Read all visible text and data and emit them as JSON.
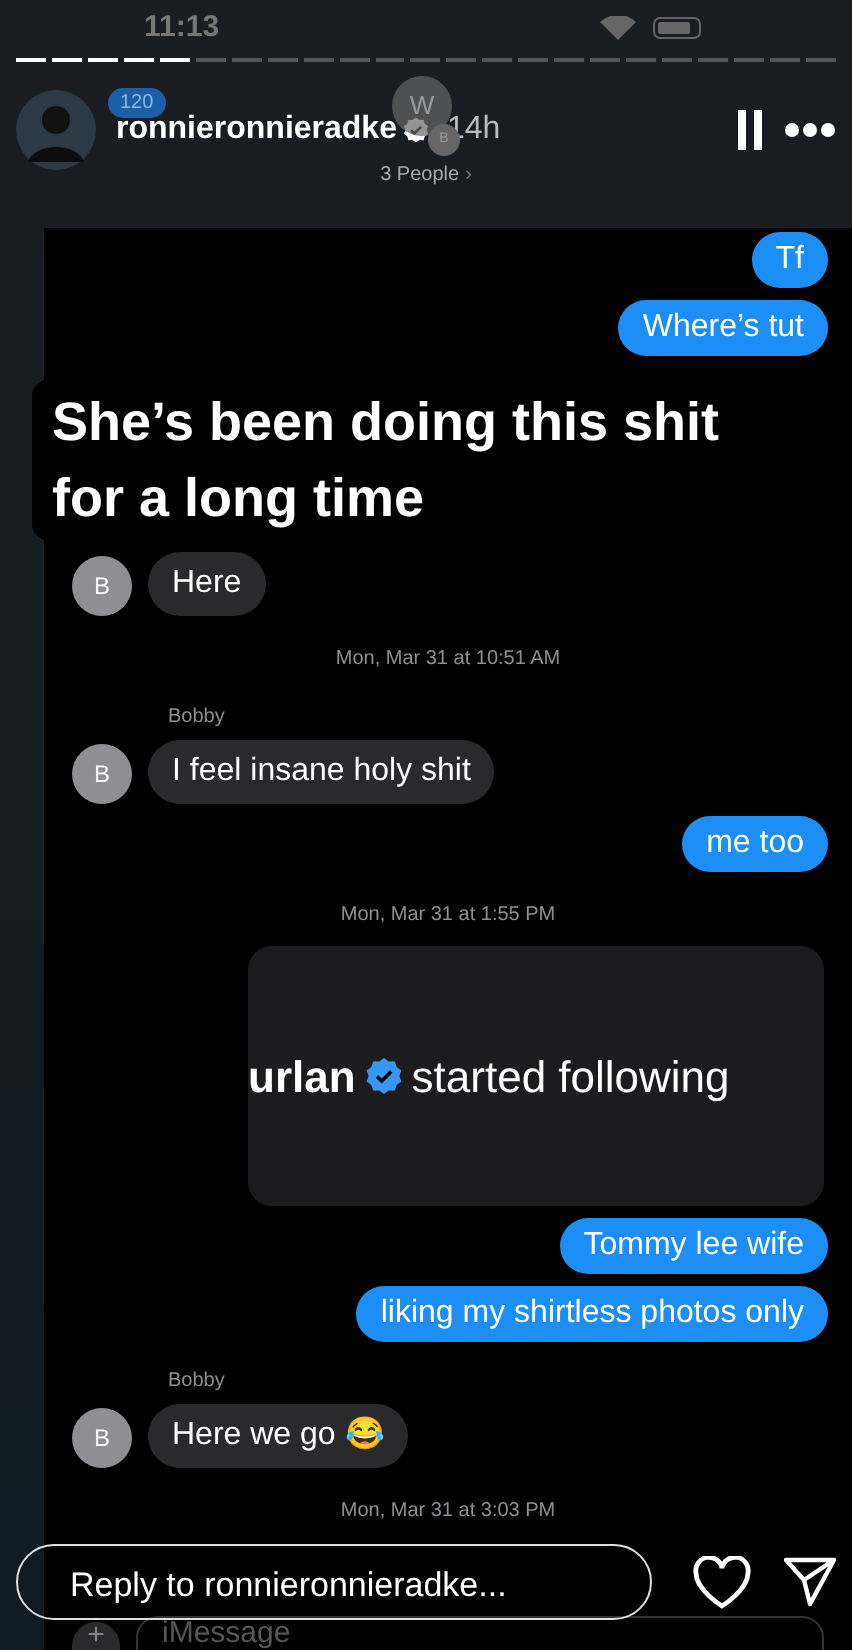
{
  "status_bar": {
    "time": "11:13"
  },
  "story": {
    "segments": [
      {
        "seen": true
      },
      {
        "seen": true
      },
      {
        "seen": true
      },
      {
        "seen": true
      },
      {
        "seen": true
      },
      {
        "seen": false
      },
      {
        "seen": false
      },
      {
        "seen": false
      },
      {
        "seen": false
      },
      {
        "seen": false
      },
      {
        "seen": false
      },
      {
        "seen": false
      },
      {
        "seen": false
      },
      {
        "seen": false
      },
      {
        "seen": false
      },
      {
        "seen": false
      },
      {
        "seen": false
      },
      {
        "seen": false
      },
      {
        "seen": false
      },
      {
        "seen": false
      },
      {
        "seen": false
      },
      {
        "seen": false
      },
      {
        "seen": false
      }
    ],
    "badge": "120",
    "username": "ronnieronnieradke",
    "verified": true,
    "age": "14h"
  },
  "chat_header": {
    "avatars": [
      "W",
      "B"
    ],
    "people": "3 People",
    "chevron": "›"
  },
  "caption": [
    "She’s been doing this shit",
    "for a long time"
  ],
  "messages": [
    {
      "kind": "sent",
      "text": "Tf"
    },
    {
      "kind": "sent",
      "text": "Where’s tut"
    },
    {
      "kind": "gap"
    },
    {
      "kind": "received",
      "avatar": "B",
      "text": "Here"
    },
    {
      "kind": "timestamp",
      "text": "Mon, Mar 31 at 10:51 AM"
    },
    {
      "kind": "sender",
      "text": "Bobby"
    },
    {
      "kind": "received",
      "avatar": "B",
      "text": "I feel insane holy shit"
    },
    {
      "kind": "sent",
      "text": "me too"
    },
    {
      "kind": "timestamp",
      "text": "Mon, Mar 31 at 1:55 PM"
    },
    {
      "kind": "card",
      "name": "urlan",
      "verified": true,
      "text": "started following"
    },
    {
      "kind": "sent",
      "text": "Tommy lee wife"
    },
    {
      "kind": "sent",
      "text": "liking my shirtless photos only"
    },
    {
      "kind": "sender",
      "text": "Bobby"
    },
    {
      "kind": "received",
      "avatar": "B",
      "text": "Here we go 😂"
    },
    {
      "kind": "timestamp",
      "text": "Mon, Mar 31 at 3:03 PM"
    }
  ],
  "compose": {
    "plus": "+",
    "placeholder": "iMessage"
  },
  "reply": {
    "placeholder": "Reply to ronnieronnieradke..."
  }
}
